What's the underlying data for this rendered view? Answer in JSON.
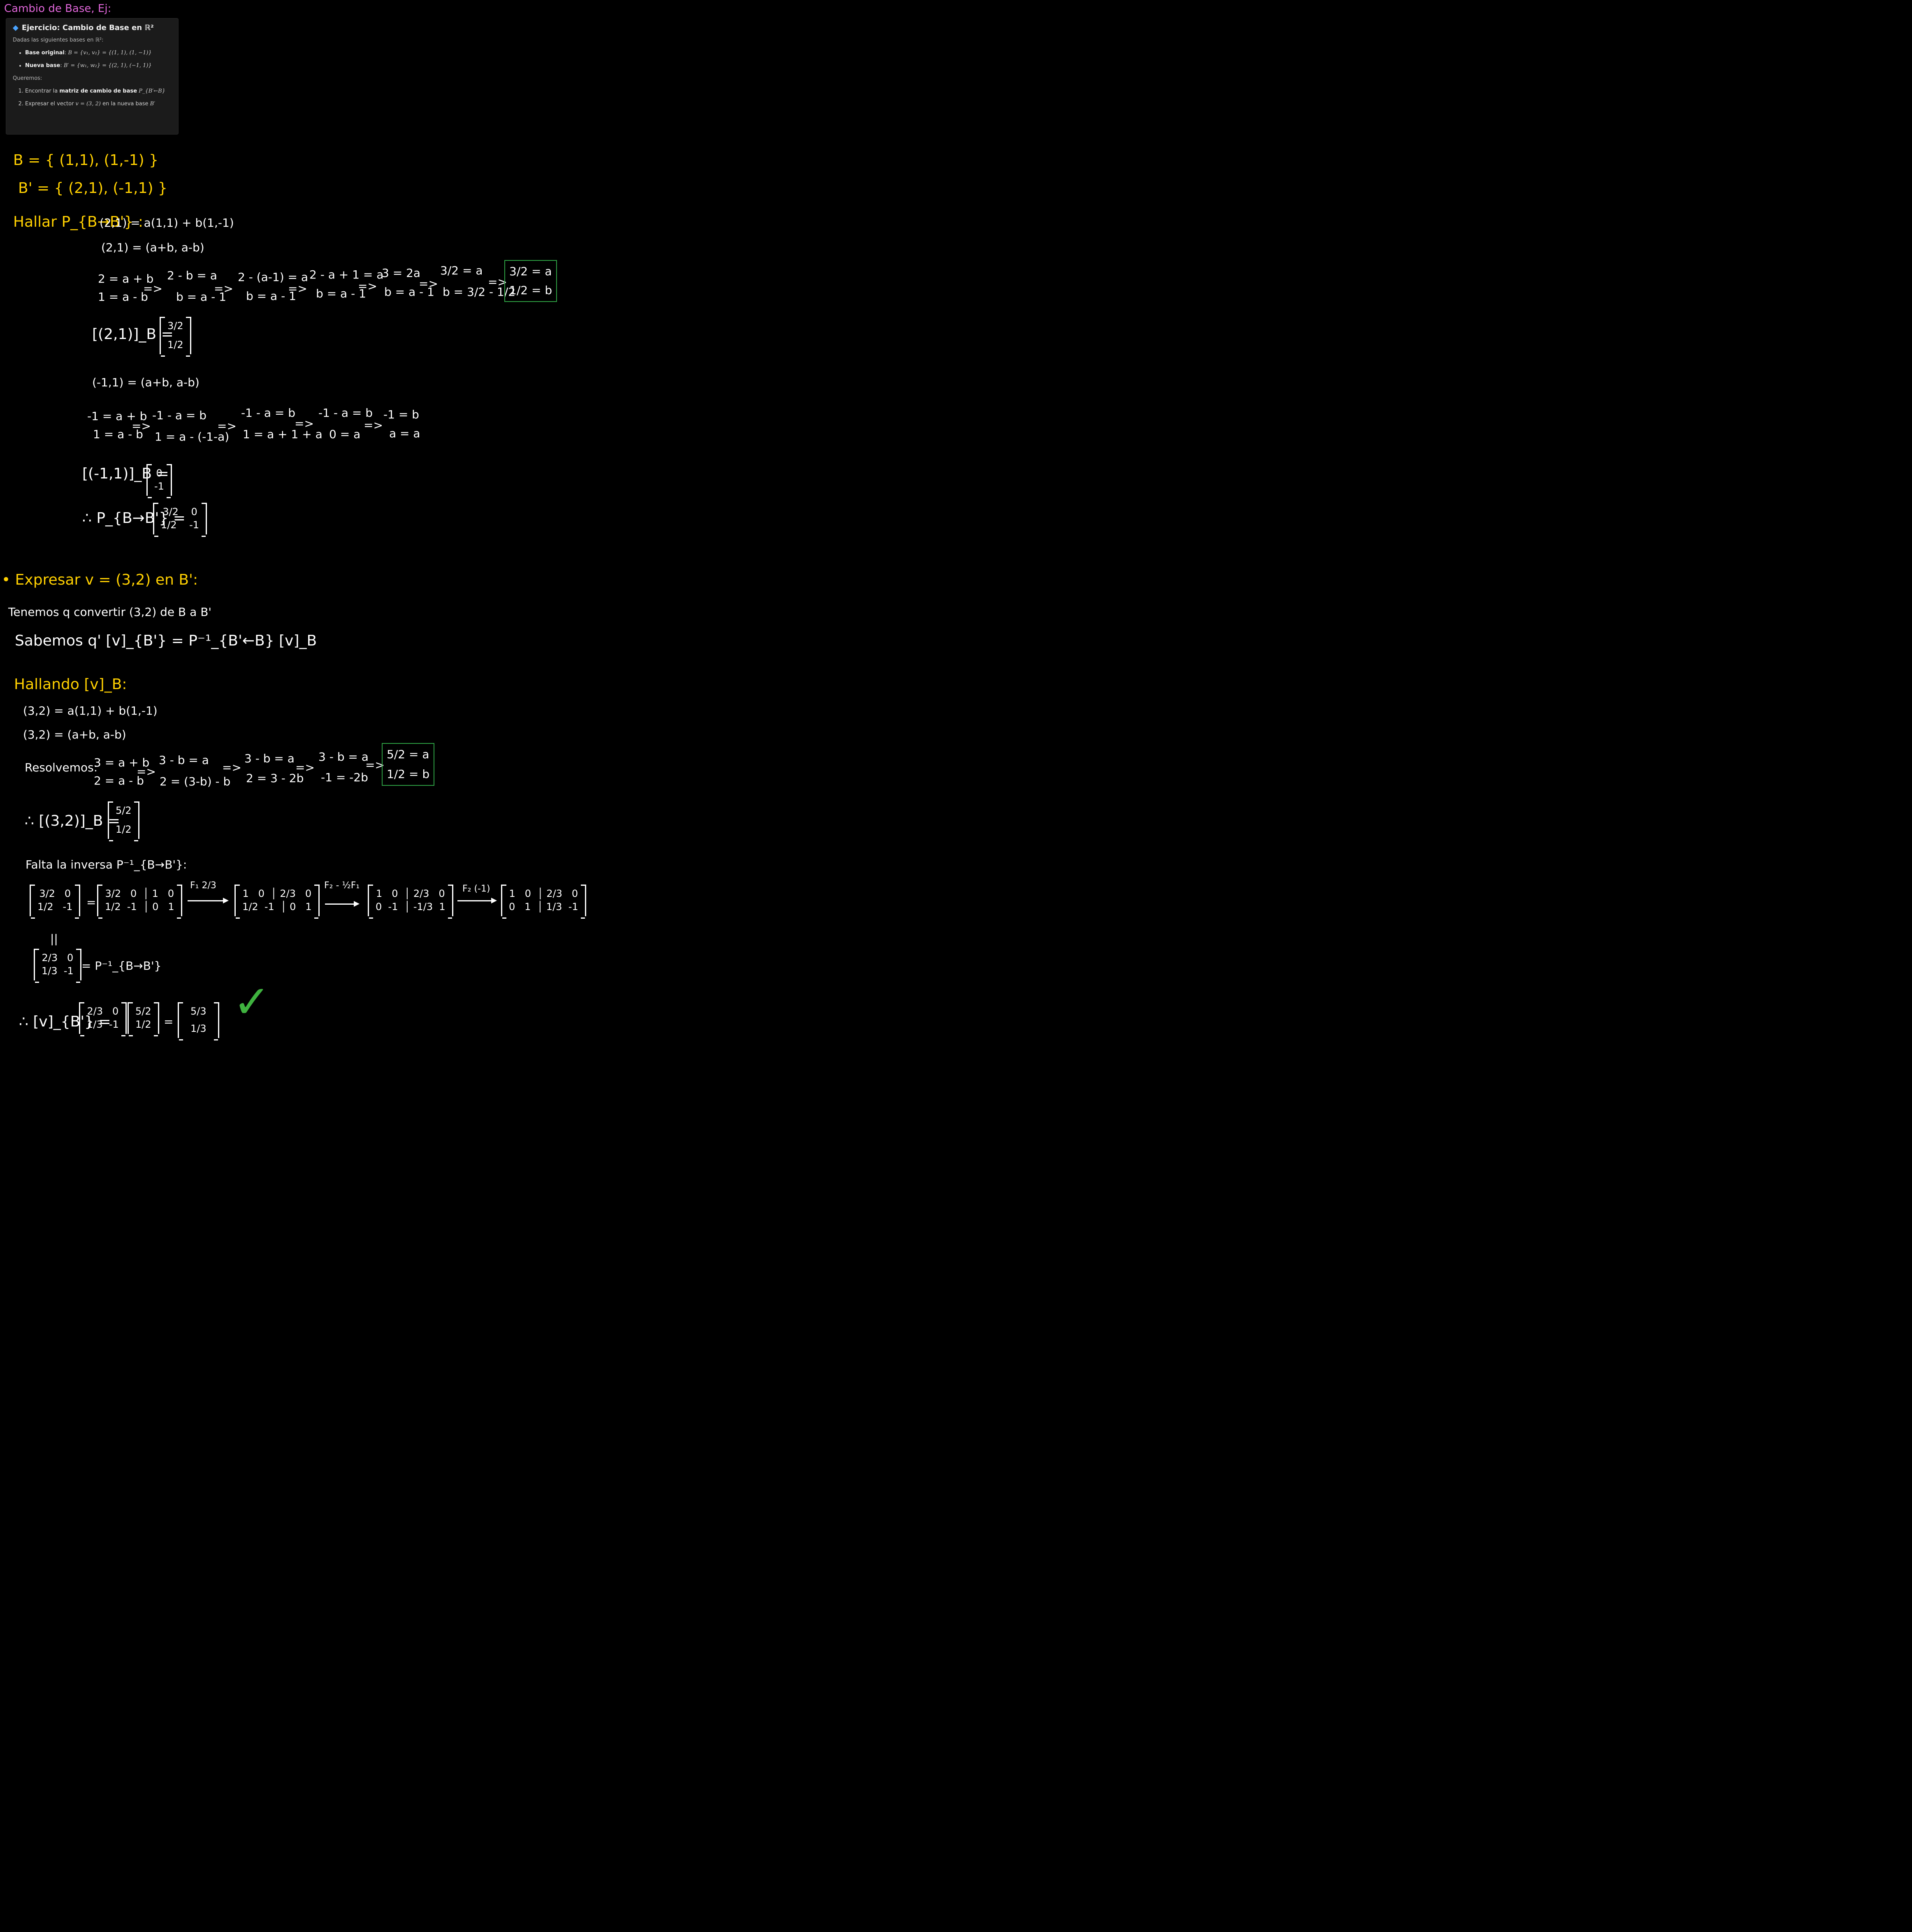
{
  "heading": "Cambio de Base, Ej:",
  "card": {
    "diamond": "◆",
    "title": "Ejercicio: Cambio de Base en ℝ²",
    "intro": "Dadas las siguientes bases en ℝ²:",
    "bullets": [
      {
        "label": "Base original",
        "math": "B = {v₁, v₂} = {(1, 1), (1, −1)}"
      },
      {
        "label": "Nueva base",
        "math": "B′ = {w₁, w₂} = {(2, 1), (−1, 1)}"
      }
    ],
    "queremos": "Queremos:",
    "tasks": [
      {
        "pre": "Encontrar la ",
        "bold": "matriz de cambio de base",
        "math": "P_{B′←B}"
      },
      {
        "pre": "Expresar el vector ",
        "math": "v = (3, 2)",
        "post": " en la nueva base ",
        "math2": "B′"
      }
    ]
  },
  "notes": {
    "B": "B = { (1,1), (1,-1) }",
    "Bp": "B' = { (2,1), (-1,1) }",
    "hallar": "Hallar P_{B→B'} :",
    "eq1": "(2,1) = a(1,1) + b(1,-1)",
    "eq2": "(2,1) = (a+b, a-b)",
    "sys1_a": "2 = a + b",
    "sys1_b": "1 = a - b",
    "s1": [
      "2 - b = a",
      "b = a - 1"
    ],
    "s2": [
      "2 - (a-1) = a",
      "b = a - 1"
    ],
    "s3": [
      "2 - a + 1 = a",
      "b = a - 1"
    ],
    "s4": [
      "3 = 2a",
      "b = a - 1"
    ],
    "s5": [
      "3/2 = a",
      "b = 3/2 - 1/2"
    ],
    "res1": [
      "3/2 = a",
      "1/2 = b"
    ],
    "coord1_label": "[(2,1)]_B =",
    "coord1": [
      "3/2",
      "1/2"
    ],
    "eq3": "(-1,1) = (a+b, a-b)",
    "sys2_a": "-1 = a + b",
    "sys2_b": "1 = a - b",
    "t1": [
      "-1 - a = b",
      "1 = a - (-1-a)"
    ],
    "t2": [
      "-1 - a = b",
      "1 = a + 1 + a"
    ],
    "t3": [
      "-1 - a = b",
      "0 = a"
    ],
    "t4": [
      "-1 = b",
      "a = a"
    ],
    "coord2_label": "[(-1,1)]_B =",
    "coord2": [
      "0",
      "-1"
    ],
    "P_label": "∴ P_{B→B'} =",
    "P": [
      [
        "3/2",
        "0"
      ],
      [
        "1/2",
        "-1"
      ]
    ],
    "expresar": "• Expresar v = (3,2) en B':",
    "tenemos": "Tenemos q convertir (3,2) de B a B'",
    "sabemos": "Sabemos q' [v]_{B'} = P⁻¹_{B'←B} [v]_B",
    "hallando": "Hallando [v]_B:",
    "eq4": "(3,2) = a(1,1) + b(1,-1)",
    "eq5": "(3,2) = (a+b, a-b)",
    "resolvemos": "Resolvemos:",
    "sys3_a": "3 = a + b",
    "sys3_b": "2 = a - b",
    "u1": [
      "3 - b = a",
      "2 = (3-b) - b"
    ],
    "u2": [
      "3 - b = a",
      "2 = 3 - 2b"
    ],
    "u3": [
      "3 - b = a",
      "-1 = -2b"
    ],
    "res2": [
      "5/2 = a",
      "1/2 = b"
    ],
    "coord3_label": "∴ [(3,2)]_B =",
    "coord3": [
      "5/2",
      "1/2"
    ],
    "falta": "Falta la inversa P⁻¹_{B→B'}:",
    "inv_m": [
      [
        "3/2",
        "0"
      ],
      [
        "1/2",
        "-1"
      ]
    ],
    "aug0": [
      [
        "3/2",
        "0",
        "1",
        "0"
      ],
      [
        "1/2",
        "-1",
        "0",
        "1"
      ]
    ],
    "op1": "F₁ 2/3",
    "aug1": [
      [
        "1",
        "0",
        "2/3",
        "0"
      ],
      [
        "1/2",
        "-1",
        "0",
        "1"
      ]
    ],
    "op2": "F₂ - ½F₁",
    "aug2": [
      [
        "1",
        "0",
        "2/3",
        "0"
      ],
      [
        "0",
        "-1",
        "-1/3",
        "1"
      ]
    ],
    "op3": "F₂ (-1)",
    "aug3": [
      [
        "1",
        "0",
        "2/3",
        "0"
      ],
      [
        "0",
        "1",
        "1/3",
        "-1"
      ]
    ],
    "eqsign": "=",
    "parallel": "||",
    "Pinv_label": "= P⁻¹_{B→B'}",
    "Pinv": [
      [
        "2/3",
        "0"
      ],
      [
        "1/3",
        "-1"
      ]
    ],
    "final_label": "∴ [v]_{B'} =",
    "final_m": [
      [
        "2/3",
        "0"
      ],
      [
        "1/3",
        "-1"
      ]
    ],
    "final_v": [
      "5/2",
      "1/2"
    ],
    "final_r": [
      "5/3",
      "1/3"
    ],
    "arrow": "=>",
    "check": "✓"
  },
  "colors": {
    "background": "#000000",
    "ink": "#ffffff",
    "yellow": "#ffd000",
    "magenta": "#e066d9",
    "green": "#3fb23f",
    "card_bg": "#1b1b1b",
    "accent": "#4aa3ff"
  }
}
